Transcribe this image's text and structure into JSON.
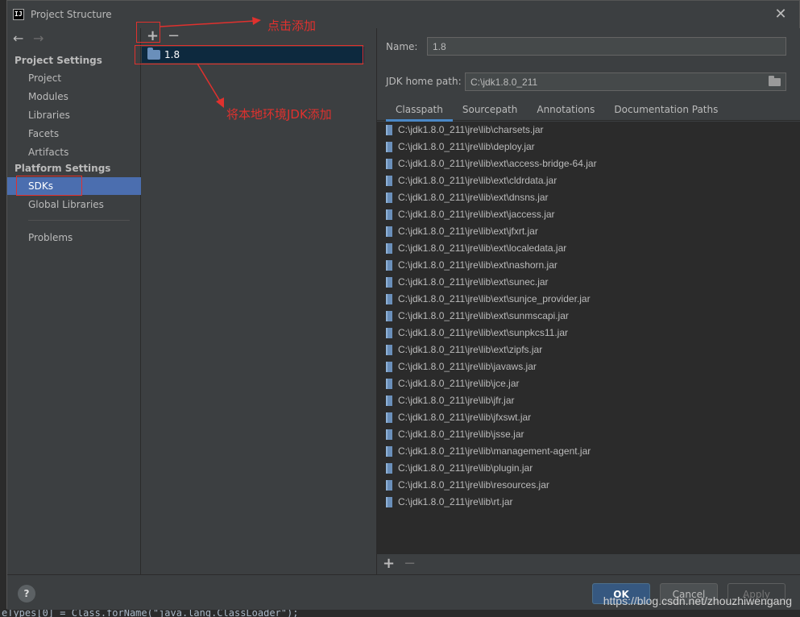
{
  "window": {
    "title": "Project Structure",
    "close_glyph": "✕"
  },
  "nav": {
    "back_glyph": "←",
    "forward_glyph": "→",
    "project_settings_header": "Project Settings",
    "project_items": [
      "Project",
      "Modules",
      "Libraries",
      "Facets",
      "Artifacts"
    ],
    "platform_settings_header": "Platform Settings",
    "platform_items": [
      "SDKs",
      "Global Libraries"
    ],
    "problems": "Problems",
    "selected": "SDKs"
  },
  "sdk_list": {
    "add_glyph": "+",
    "remove_glyph": "−",
    "items": [
      "1.8"
    ]
  },
  "details": {
    "name_label": "Name:",
    "name_value": "1.8",
    "jdk_home_label": "JDK home path:",
    "jdk_home_value": "C:\\jdk1.8.0_211",
    "tabs": [
      "Classpath",
      "Sourcepath",
      "Annotations",
      "Documentation Paths"
    ],
    "active_tab": "Classpath",
    "classpath": [
      "C:\\jdk1.8.0_211\\jre\\lib\\charsets.jar",
      "C:\\jdk1.8.0_211\\jre\\lib\\deploy.jar",
      "C:\\jdk1.8.0_211\\jre\\lib\\ext\\access-bridge-64.jar",
      "C:\\jdk1.8.0_211\\jre\\lib\\ext\\cldrdata.jar",
      "C:\\jdk1.8.0_211\\jre\\lib\\ext\\dnsns.jar",
      "C:\\jdk1.8.0_211\\jre\\lib\\ext\\jaccess.jar",
      "C:\\jdk1.8.0_211\\jre\\lib\\ext\\jfxrt.jar",
      "C:\\jdk1.8.0_211\\jre\\lib\\ext\\localedata.jar",
      "C:\\jdk1.8.0_211\\jre\\lib\\ext\\nashorn.jar",
      "C:\\jdk1.8.0_211\\jre\\lib\\ext\\sunec.jar",
      "C:\\jdk1.8.0_211\\jre\\lib\\ext\\sunjce_provider.jar",
      "C:\\jdk1.8.0_211\\jre\\lib\\ext\\sunmscapi.jar",
      "C:\\jdk1.8.0_211\\jre\\lib\\ext\\sunpkcs11.jar",
      "C:\\jdk1.8.0_211\\jre\\lib\\ext\\zipfs.jar",
      "C:\\jdk1.8.0_211\\jre\\lib\\javaws.jar",
      "C:\\jdk1.8.0_211\\jre\\lib\\jce.jar",
      "C:\\jdk1.8.0_211\\jre\\lib\\jfr.jar",
      "C:\\jdk1.8.0_211\\jre\\lib\\jfxswt.jar",
      "C:\\jdk1.8.0_211\\jre\\lib\\jsse.jar",
      "C:\\jdk1.8.0_211\\jre\\lib\\management-agent.jar",
      "C:\\jdk1.8.0_211\\jre\\lib\\plugin.jar",
      "C:\\jdk1.8.0_211\\jre\\lib\\resources.jar",
      "C:\\jdk1.8.0_211\\jre\\lib\\rt.jar"
    ],
    "list_add_glyph": "+",
    "list_remove_glyph": "−"
  },
  "buttons": {
    "help": "?",
    "ok": "OK",
    "cancel": "Cancel",
    "apply": "Apply"
  },
  "annotations": {
    "click_add": "点击添加",
    "add_local_jdk": "将本地环境JDK添加",
    "color": "#e0312e"
  },
  "editor_bottom_code": "eTypes[0] = Class.forName(\"java.lang.ClassLoader\");",
  "watermark": "https://blog.csdn.net/zhouzhiwengang"
}
